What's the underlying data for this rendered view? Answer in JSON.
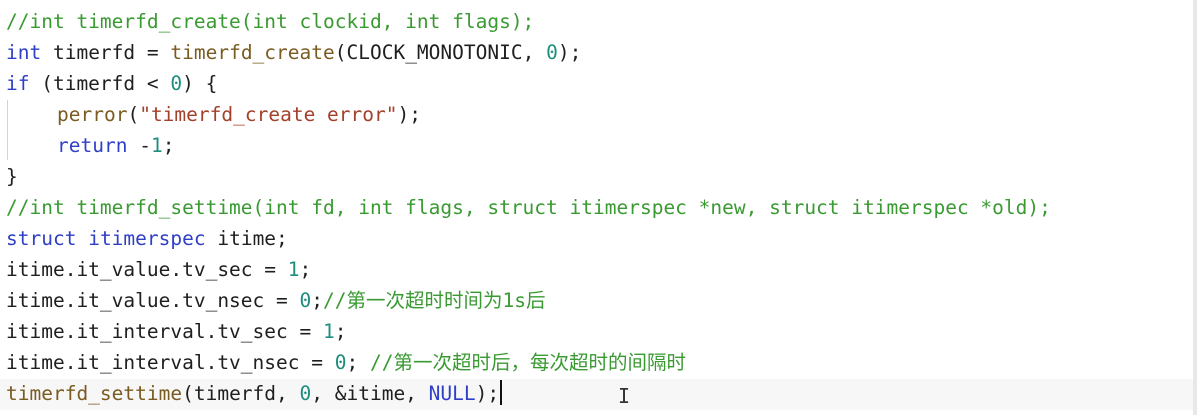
{
  "editor": {
    "lines": [
      [
        {
          "t": "//int timerfd_create(int clockid, int flags);",
          "c": "cm"
        }
      ],
      [
        {
          "t": "int",
          "c": "kw"
        },
        {
          "t": " timerfd = ",
          "c": "pn"
        },
        {
          "t": "timerfd_create",
          "c": "fn"
        },
        {
          "t": "(CLOCK_MONOTONIC, ",
          "c": "pn"
        },
        {
          "t": "0",
          "c": "nu"
        },
        {
          "t": ");",
          "c": "pn"
        }
      ],
      [
        {
          "t": "if",
          "c": "kw"
        },
        {
          "t": " (timerfd < ",
          "c": "pn"
        },
        {
          "t": "0",
          "c": "nu"
        },
        {
          "t": ") {",
          "c": "pn"
        }
      ],
      [
        {
          "t": "",
          "c": "indent"
        },
        {
          "t": "perror",
          "c": "fn"
        },
        {
          "t": "(",
          "c": "pn"
        },
        {
          "t": "\"timerfd_create error\"",
          "c": "st"
        },
        {
          "t": ");",
          "c": "pn"
        }
      ],
      [
        {
          "t": "",
          "c": "indent"
        },
        {
          "t": "return",
          "c": "kw"
        },
        {
          "t": " -",
          "c": "pn"
        },
        {
          "t": "1",
          "c": "nu"
        },
        {
          "t": ";",
          "c": "pn"
        }
      ],
      [
        {
          "t": "}",
          "c": "pn"
        }
      ],
      [
        {
          "t": "//int timerfd_settime(int fd, int flags, struct itimerspec *new, struct itimerspec *old);",
          "c": "cm"
        }
      ],
      [
        {
          "t": "struct",
          "c": "kw"
        },
        {
          "t": " ",
          "c": "pn"
        },
        {
          "t": "itimerspec",
          "c": "ty"
        },
        {
          "t": " itime;",
          "c": "pn"
        }
      ],
      [
        {
          "t": "itime.it_value.tv_sec = ",
          "c": "pn"
        },
        {
          "t": "1",
          "c": "nu"
        },
        {
          "t": ";",
          "c": "pn"
        }
      ],
      [
        {
          "t": "itime.it_value.tv_nsec = ",
          "c": "pn"
        },
        {
          "t": "0",
          "c": "nu"
        },
        {
          "t": ";",
          "c": "pn"
        },
        {
          "t": "//第一次超时时间为1s后",
          "c": "cm"
        }
      ],
      [
        {
          "t": "itime.it_interval.tv_sec = ",
          "c": "pn"
        },
        {
          "t": "1",
          "c": "nu"
        },
        {
          "t": ";",
          "c": "pn"
        }
      ],
      [
        {
          "t": "itime.it_interval.tv_nsec = ",
          "c": "pn"
        },
        {
          "t": "0",
          "c": "nu"
        },
        {
          "t": "; ",
          "c": "pn"
        },
        {
          "t": "//第一次超时后，每次超时的间隔时",
          "c": "cm"
        }
      ],
      [
        {
          "t": "timerfd_settime",
          "c": "fn"
        },
        {
          "t": "(timerfd, ",
          "c": "pn"
        },
        {
          "t": "0",
          "c": "nu"
        },
        {
          "t": ", &itime, ",
          "c": "pn"
        },
        {
          "t": "NULL",
          "c": "kw"
        },
        {
          "t": ");",
          "c": "pn"
        }
      ]
    ],
    "cursor_line": 13,
    "mouse_cursor": "I"
  },
  "colors": {
    "comment": "#3a9a32",
    "keyword": "#2f3fc6",
    "function": "#7a5b21",
    "number": "#1e8e7e",
    "string": "#a3402a",
    "text": "#1f1f1f"
  }
}
